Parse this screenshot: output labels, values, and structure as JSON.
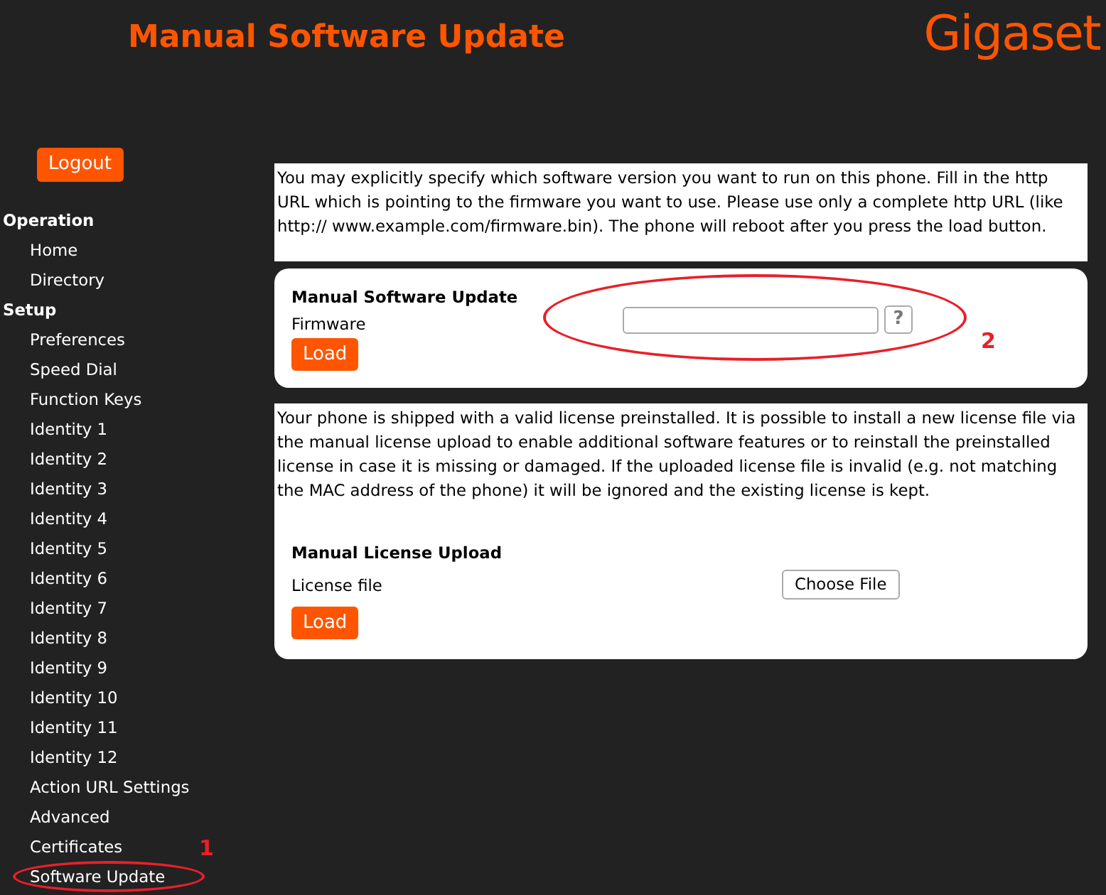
{
  "header": {
    "title": "Manual Software Update",
    "logo": "Gigaset"
  },
  "sidebar": {
    "logout": "Logout",
    "sections": [
      {
        "label": "Operation",
        "items": [
          "Home",
          "Directory"
        ]
      },
      {
        "label": "Setup",
        "items": [
          "Preferences",
          "Speed Dial",
          "Function Keys",
          "Identity 1",
          "Identity 2",
          "Identity 3",
          "Identity 4",
          "Identity 5",
          "Identity 6",
          "Identity 7",
          "Identity 8",
          "Identity 9",
          "Identity 10",
          "Identity 11",
          "Identity 12",
          "Action URL Settings",
          "Advanced",
          "Certificates",
          "Software Update"
        ]
      }
    ]
  },
  "software_intro": "You may explicitly specify which software version you want to run on this phone. Fill in the http URL which is pointing to the firmware you want to use. Please use only a complete http URL (like http:// www.example.com/firmware.bin). The phone will reboot after you press the load button.",
  "software_card": {
    "title": "Manual Software Update",
    "label": "Firmware",
    "help": "?",
    "button": "Load"
  },
  "license_intro": "Your phone is shipped with a valid license preinstalled. It is possible to install a new license file via the manual license upload to enable additional software features or to reinstall the preinstalled license in case it is missing or damaged. If the uploaded license file is invalid (e.g. not matching the MAC address of the phone) it will be ignored and the existing license is kept.",
  "license_card": {
    "title": "Manual License Upload",
    "label": "License file",
    "file_button": "Choose File",
    "button": "Load"
  },
  "annotations": [
    "1",
    "2"
  ]
}
